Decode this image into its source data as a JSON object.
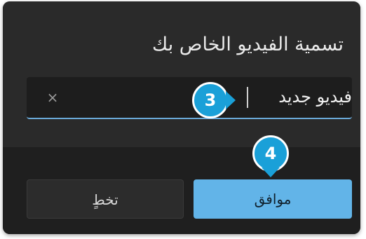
{
  "dialog": {
    "title": "تسمية الفيديو الخاص بك",
    "input": {
      "value": "فيديو جديد",
      "clear_icon": "close-icon",
      "clear_glyph": "×"
    },
    "buttons": {
      "cancel_label": "تخطٍ",
      "ok_label": "موافق"
    }
  },
  "annotations": {
    "step_3": "3",
    "step_4": "4"
  },
  "colors": {
    "accent": "#62b4e8",
    "badge": "#1aa0d8",
    "dialog_bg": "#2a2a2a",
    "footer_bg": "#1f1f1f"
  }
}
